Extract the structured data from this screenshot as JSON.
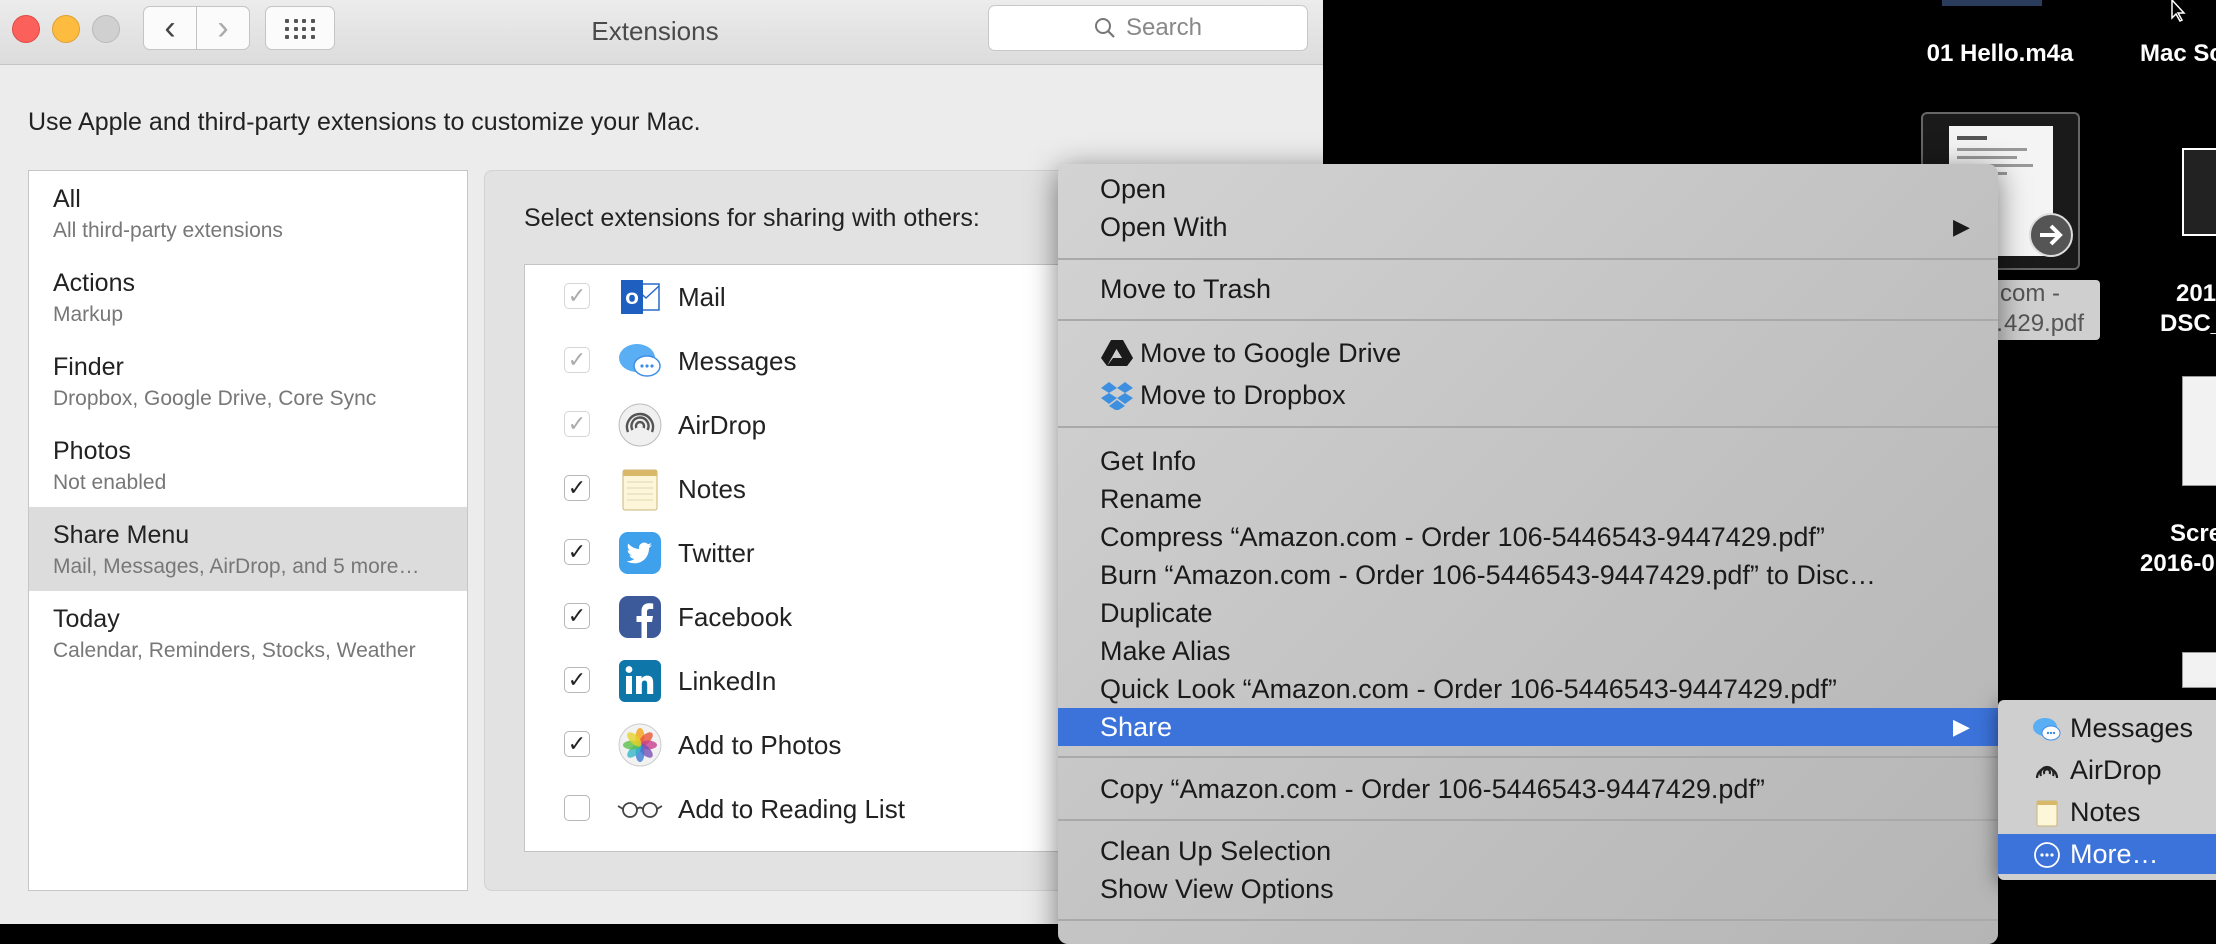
{
  "window": {
    "title": "Extensions",
    "search_placeholder": "Search",
    "back_glyph": "‹",
    "forward_glyph": "›",
    "intro": "Use Apple and third-party extensions to customize your Mac."
  },
  "categories": [
    {
      "title": "All",
      "subtitle": "All third-party extensions"
    },
    {
      "title": "Actions",
      "subtitle": "Markup"
    },
    {
      "title": "Finder",
      "subtitle": "Dropbox, Google Drive, Core Sync"
    },
    {
      "title": "Photos",
      "subtitle": "Not enabled"
    },
    {
      "title": "Share Menu",
      "subtitle": "Mail, Messages, AirDrop, and 5 more…",
      "selected": true
    },
    {
      "title": "Today",
      "subtitle": "Calendar, Reminders, Stocks, Weather"
    }
  ],
  "share_panel": {
    "heading": "Select extensions for sharing with others:",
    "extensions": [
      {
        "label": "Mail",
        "checked": true,
        "locked": true,
        "icon": "outlook-icon"
      },
      {
        "label": "Messages",
        "checked": true,
        "locked": true,
        "icon": "messages-icon"
      },
      {
        "label": "AirDrop",
        "checked": true,
        "locked": true,
        "icon": "airdrop-icon"
      },
      {
        "label": "Notes",
        "checked": true,
        "locked": false,
        "icon": "notes-icon"
      },
      {
        "label": "Twitter",
        "checked": true,
        "locked": false,
        "icon": "twitter-icon"
      },
      {
        "label": "Facebook",
        "checked": true,
        "locked": false,
        "icon": "facebook-icon"
      },
      {
        "label": "LinkedIn",
        "checked": true,
        "locked": false,
        "icon": "linkedin-icon"
      },
      {
        "label": "Add to Photos",
        "checked": true,
        "locked": false,
        "icon": "photos-icon"
      },
      {
        "label": "Add to Reading List",
        "checked": false,
        "locked": false,
        "icon": "glasses-icon"
      }
    ]
  },
  "desktop": {
    "file1": "01 Hello.m4a",
    "file2_partial": "Mac Sc",
    "selected_file_line1": "n.com -",
    "selected_file_line2": "…429.pdf",
    "file3_line1": "201",
    "file3_line2": "DSC_",
    "file4_line1": "Scre",
    "file4_line2": "2016-0"
  },
  "context_menu": {
    "open": "Open",
    "open_with": "Open With",
    "move_to_trash": "Move to Trash",
    "move_to_google_drive": "Move to Google Drive",
    "move_to_dropbox": "Move to Dropbox",
    "get_info": "Get Info",
    "rename": "Rename",
    "compress": "Compress “Amazon.com - Order 106-5446543-9447429.pdf”",
    "burn": "Burn “Amazon.com - Order 106-5446543-9447429.pdf” to Disc…",
    "duplicate": "Duplicate",
    "make_alias": "Make Alias",
    "quick_look": "Quick Look “Amazon.com - Order 106-5446543-9447429.pdf”",
    "share": "Share",
    "copy": "Copy “Amazon.com - Order 106-5446543-9447429.pdf”",
    "clean_up": "Clean Up Selection",
    "view_options": "Show View Options",
    "arrow": "▶"
  },
  "share_submenu": {
    "items": [
      "Messages",
      "AirDrop",
      "Notes",
      "More…"
    ]
  },
  "colors": {
    "highlight": "#3b73da",
    "close": "#fc605b",
    "minimize": "#fdbc40"
  }
}
